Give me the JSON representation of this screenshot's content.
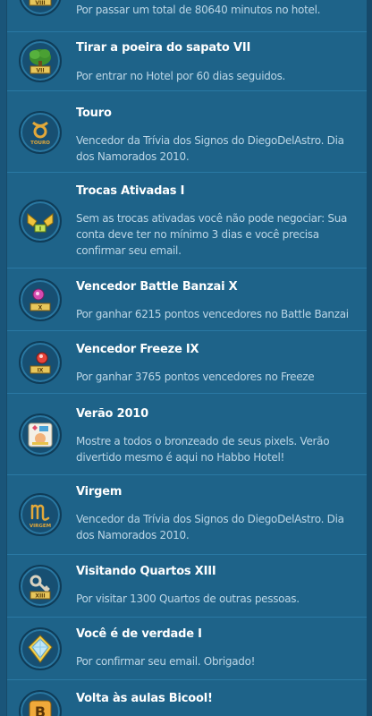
{
  "achievements": [
    {
      "title": "",
      "description": "Por passar um total de 80640 minutos no hotel.",
      "icon": "tree-badge-icon"
    },
    {
      "title": "Tirar a poeira do sapato VII",
      "description": "Por entrar no Hotel por 60 dias seguidos.",
      "icon": "tree-badge-icon"
    },
    {
      "title": "Touro",
      "description": "Vencedor da Trívia dos Signos do DiegoDelAstro. Dia dos Namorados 2010.",
      "icon": "taurus-badge-icon",
      "badge_text": "TOURO"
    },
    {
      "title": "Trocas Ativadas I",
      "description": "Sem as trocas ativadas você não pode negociar: Sua conta deve ter no mínimo 3 dias e você precisa confirmar seu email.",
      "icon": "trade-hands-badge-icon"
    },
    {
      "title": "Vencedor Battle Banzai X",
      "description": "Por ganhar 6215 pontos vencedores no Battle Banzai",
      "icon": "banzai-badge-icon"
    },
    {
      "title": "Vencedor Freeze IX",
      "description": "Por ganhar 3765 pontos vencedores no Freeze",
      "icon": "freeze-badge-icon"
    },
    {
      "title": "Verão 2010",
      "description": "Mostre a todos o bronzeado de seus pixels. Verão divertido mesmo é aqui no Habbo Hotel!",
      "icon": "summer-badge-icon"
    },
    {
      "title": "Virgem",
      "description": "Vencedor da Trívia dos Signos do DiegoDelAstro. Dia dos Namorados 2010.",
      "icon": "virgo-badge-icon",
      "badge_text": "VIRGEM"
    },
    {
      "title": "Visitando Quartos XIII",
      "description": "Por visitar 1300 Quartos de outras pessoas.",
      "icon": "key-badge-icon"
    },
    {
      "title": "Você é de verdade I",
      "description": "Por confirmar seu email. Obrigado!",
      "icon": "crystal-badge-icon"
    },
    {
      "title": "Volta às aulas Bicool!",
      "description": "",
      "icon": "bicool-badge-icon"
    }
  ],
  "colors": {
    "background": "#1e6389",
    "title": "#ffffff",
    "description": "#bcd6e6",
    "divider": "#2a79a4"
  }
}
